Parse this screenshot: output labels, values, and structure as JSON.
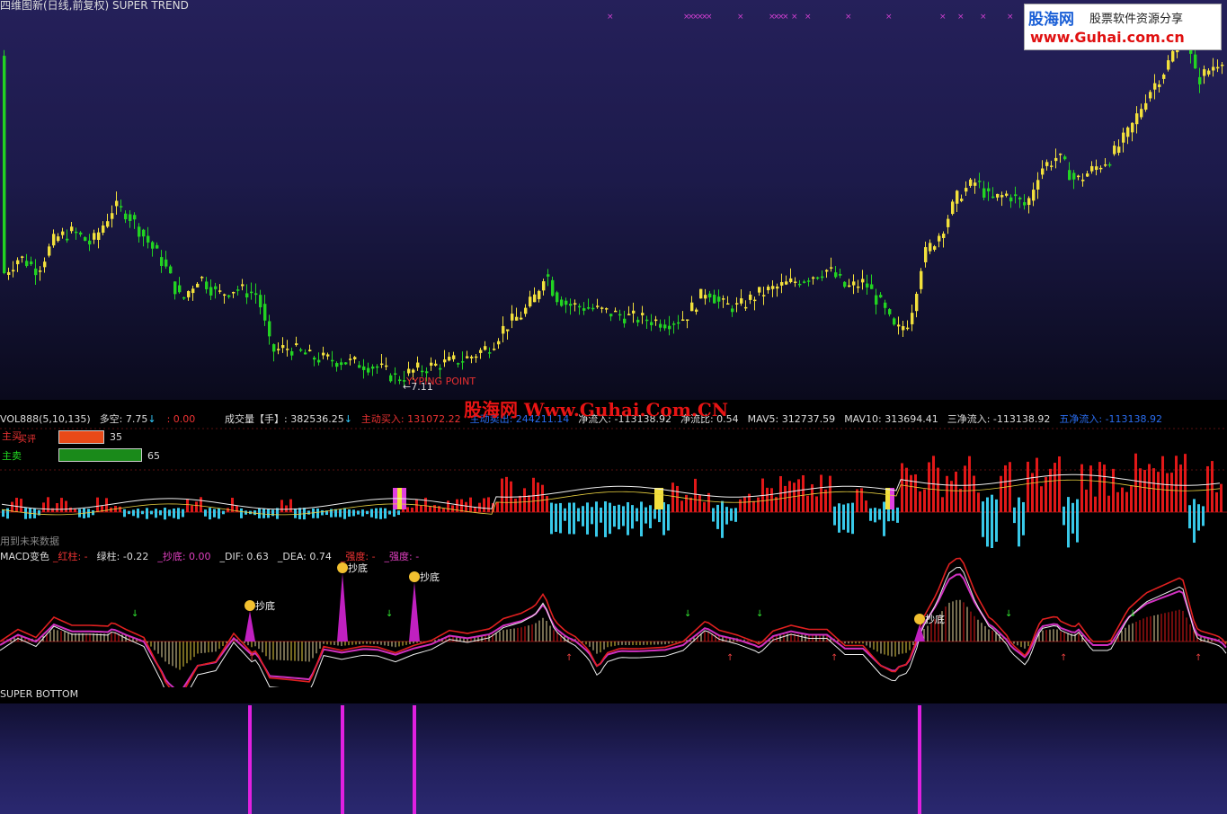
{
  "main": {
    "title": "四维图新(日线,前复权) SUPER TREND",
    "ypoint_label": "YYPING POINT",
    "low_label": "←7.11",
    "top_marker": "$"
  },
  "logo": {
    "cn": "股海网",
    "tag": "股票软件资源分享",
    "url": "www.Guhai.com.cn"
  },
  "watermark": "股海网 Www.Guhai.Com.CN",
  "vol": {
    "name": "VOL888(5,10,135)",
    "duokong": "多空: 7.75",
    "duokong_arrow": "↓",
    "neg": ": 0.00",
    "chengjiao": "成交量【手】: 382536.25",
    "chengjiao_arrow": "↓",
    "zhudong_buy": "主动买入: 131072.22",
    "zhudong_sell": "主动卖出: 244211.14",
    "jingliu": "净流入: -113138.92",
    "jingliubi": "净流比: 0.54",
    "mav5": "MAV5: 312737.59",
    "mav10": "MAV10: 313694.41",
    "sanjing": "三净流入: -113138.92",
    "wujing": "五净流入: -113138.92",
    "buy_label": "主买",
    "buy_label2": "买评",
    "buy_value": "35",
    "sell_label": "主卖",
    "sell_value": "65",
    "future_note": "用到未来数据",
    "buy_color": "#e84a18",
    "sell_color": "#1a8a1a"
  },
  "macd": {
    "name": "MACD变色",
    "red_col": "_红柱: -",
    "green_col": "绿柱: -0.22",
    "chaodi": "_抄底: 0.00",
    "dif": "_DIF: 0.63",
    "dea": "_DEA: 0.74",
    "strength1": "_强度: -",
    "strength2": "_强度: -",
    "dip_label": "抄底"
  },
  "sb": {
    "title": "SUPER BOTTOM"
  },
  "chart_data": {
    "type": "candlestick",
    "title": "四维图新(日线,前复权) SUPER TREND",
    "close_path": [
      [
        0,
        7.95
      ],
      [
        20,
        8.1
      ],
      [
        40,
        8.0
      ],
      [
        60,
        8.25
      ],
      [
        80,
        8.3
      ],
      [
        100,
        8.2
      ],
      [
        125,
        8.5
      ],
      [
        140,
        8.45
      ],
      [
        160,
        8.25
      ],
      [
        180,
        8.05
      ],
      [
        200,
        7.75
      ],
      [
        220,
        7.95
      ],
      [
        240,
        7.8
      ],
      [
        260,
        7.85
      ],
      [
        285,
        7.8
      ],
      [
        300,
        7.35
      ],
      [
        320,
        7.38
      ],
      [
        345,
        7.3
      ],
      [
        370,
        7.28
      ],
      [
        400,
        7.25
      ],
      [
        420,
        7.22
      ],
      [
        440,
        7.13
      ],
      [
        460,
        7.2
      ],
      [
        490,
        7.25
      ],
      [
        520,
        7.3
      ],
      [
        545,
        7.4
      ],
      [
        560,
        7.55
      ],
      [
        580,
        7.65
      ],
      [
        595,
        7.8
      ],
      [
        605,
        8.0
      ],
      [
        615,
        7.8
      ],
      [
        630,
        7.72
      ],
      [
        650,
        7.7
      ],
      [
        680,
        7.65
      ],
      [
        700,
        7.62
      ],
      [
        720,
        7.6
      ],
      [
        740,
        7.58
      ],
      [
        760,
        7.62
      ],
      [
        785,
        7.85
      ],
      [
        800,
        7.72
      ],
      [
        820,
        7.7
      ],
      [
        840,
        7.8
      ],
      [
        860,
        7.85
      ],
      [
        880,
        7.9
      ],
      [
        900,
        7.95
      ],
      [
        920,
        8.0
      ],
      [
        940,
        7.85
      ],
      [
        960,
        7.9
      ],
      [
        980,
        7.7
      ],
      [
        995,
        7.5
      ],
      [
        1010,
        7.6
      ],
      [
        1025,
        8.1
      ],
      [
        1045,
        8.3
      ],
      [
        1065,
        8.6
      ],
      [
        1085,
        8.7
      ],
      [
        1100,
        8.55
      ],
      [
        1120,
        8.6
      ],
      [
        1140,
        8.5
      ],
      [
        1155,
        8.8
      ],
      [
        1175,
        8.9
      ],
      [
        1195,
        8.7
      ],
      [
        1215,
        8.8
      ],
      [
        1235,
        8.9
      ],
      [
        1255,
        9.1
      ],
      [
        1275,
        9.4
      ],
      [
        1295,
        9.6
      ],
      [
        1315,
        9.9
      ],
      [
        1330,
        9.5
      ],
      [
        1345,
        9.6
      ],
      [
        1360,
        9.7
      ]
    ],
    "price_range": [
      7.0,
      10.0
    ],
    "bullish_color": "#f2e03c",
    "bearish_color": "#22d322",
    "dip_positions": [
      278,
      381,
      461,
      1023
    ],
    "annotations": [
      "YYPING POINT",
      "←7.11",
      "抄底"
    ]
  }
}
